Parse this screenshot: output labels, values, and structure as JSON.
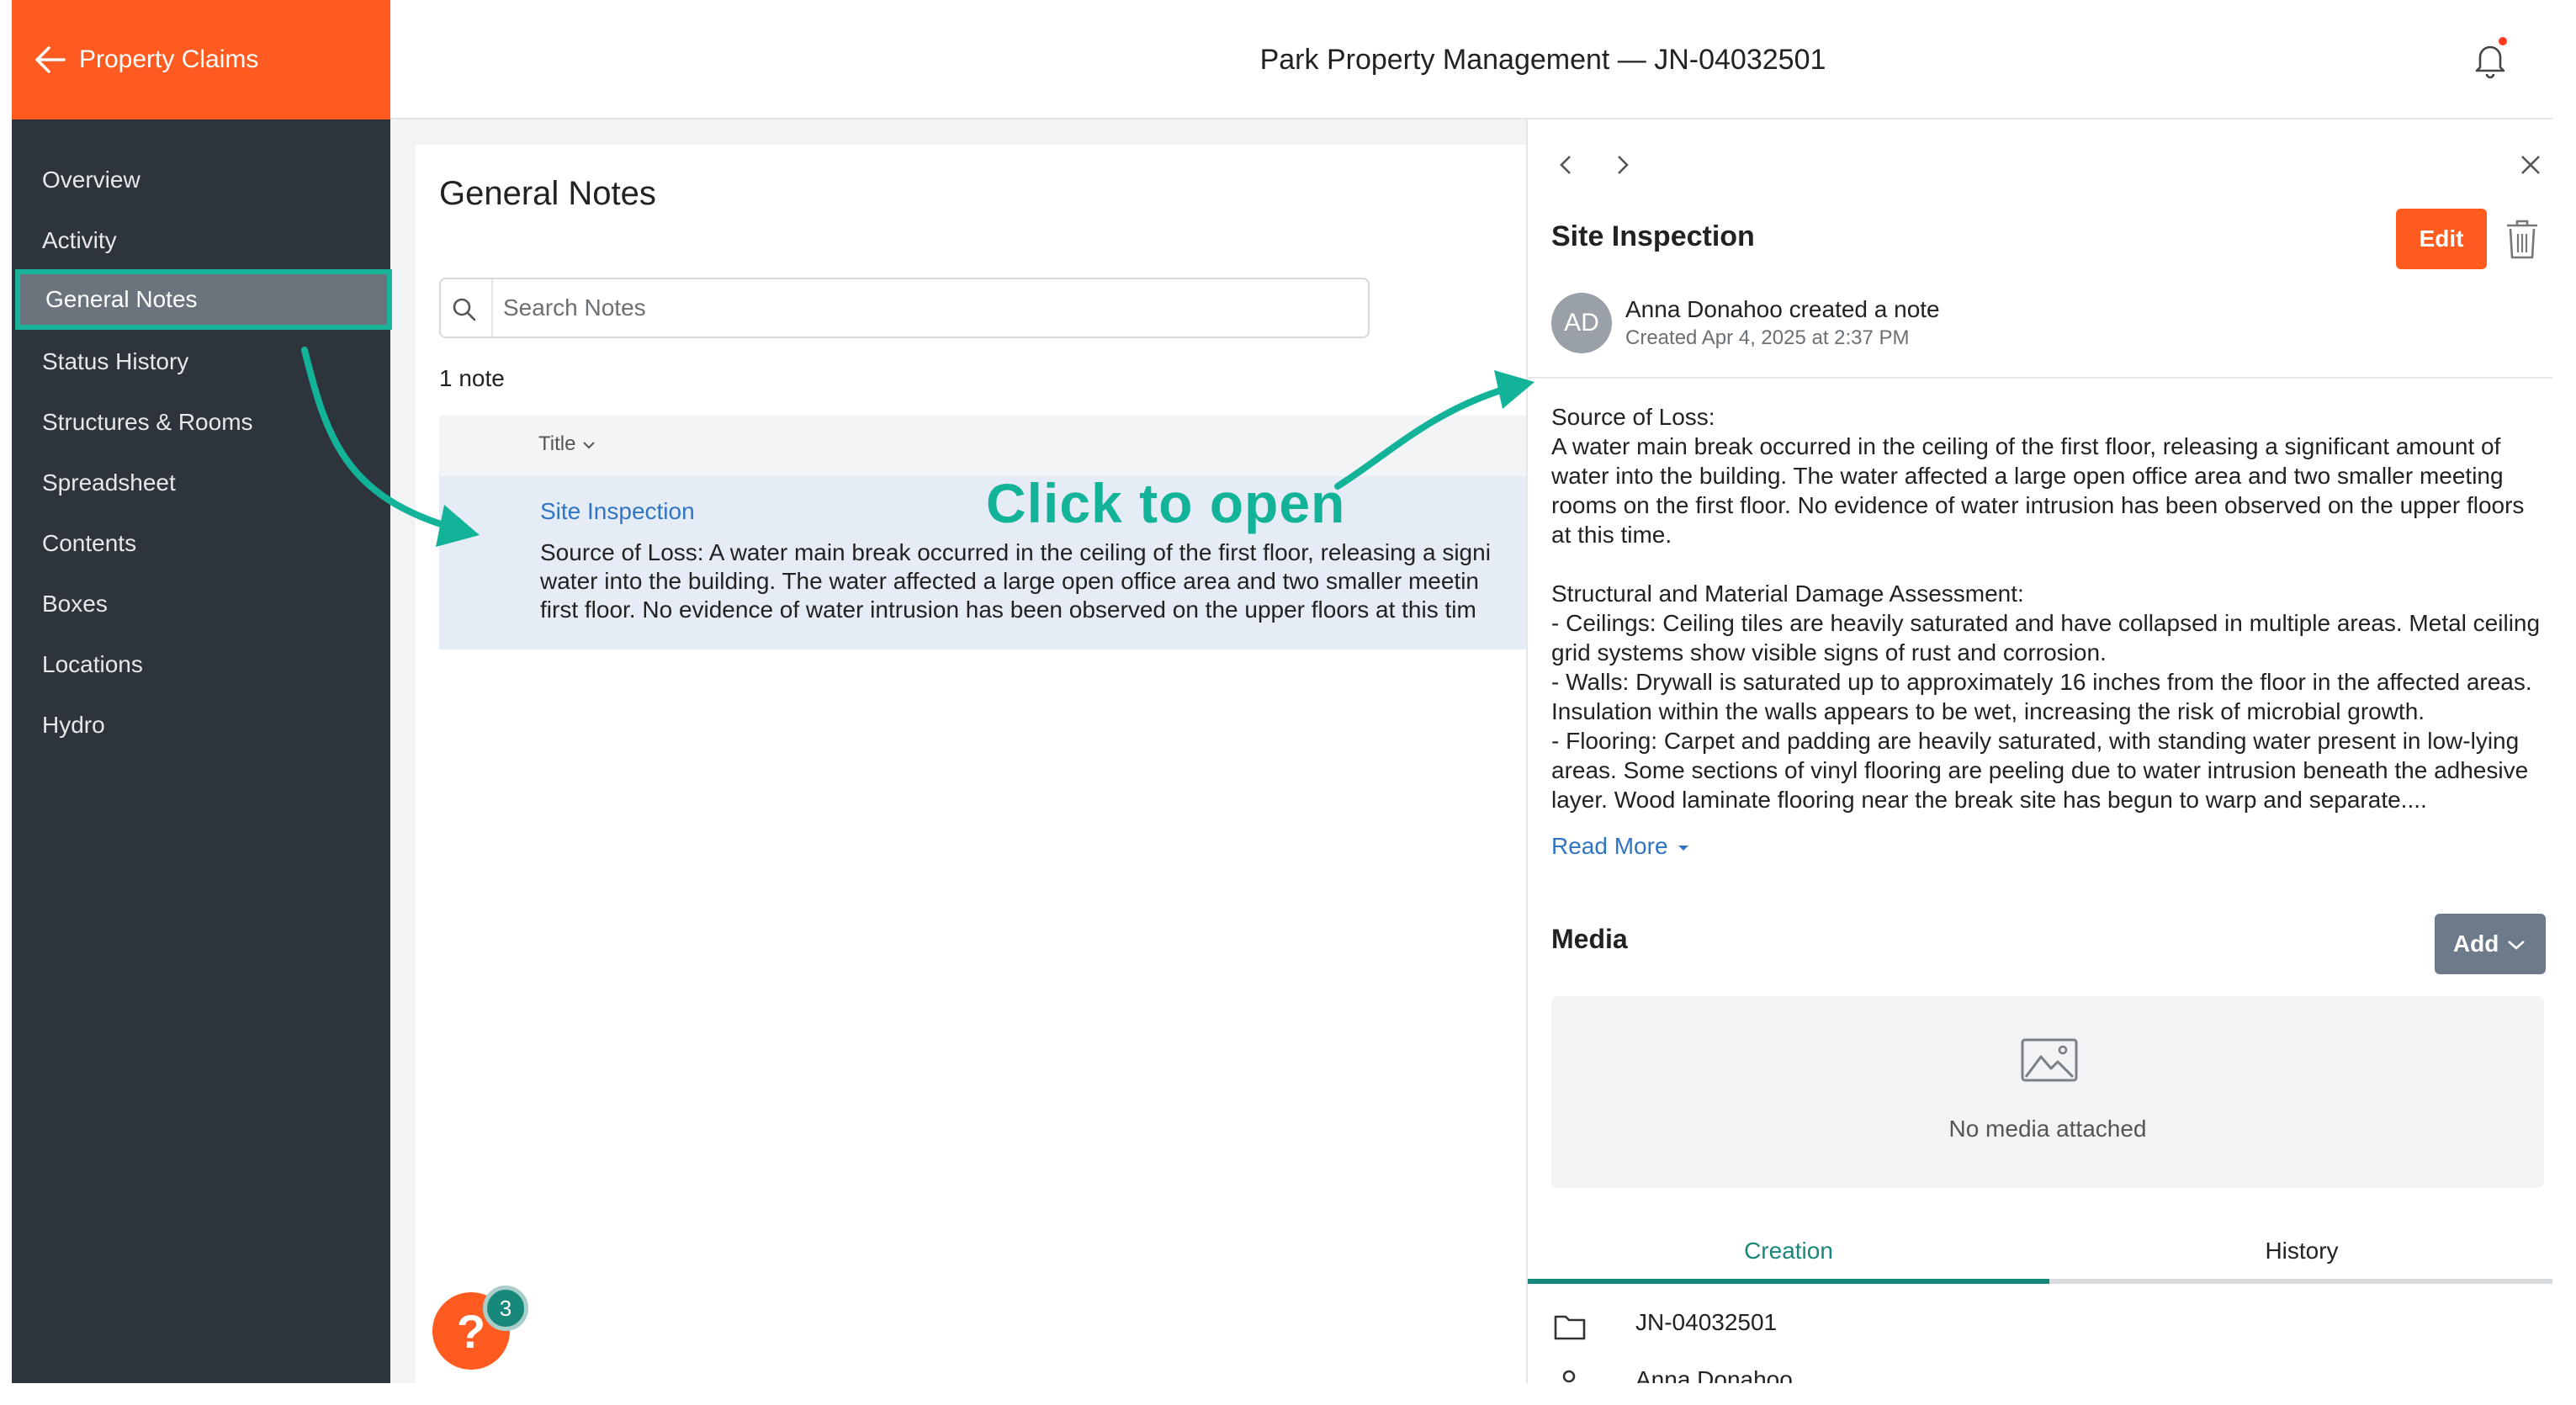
{
  "brand": {
    "back_label": "Property Claims"
  },
  "header": {
    "title": "Park Property Management — JN-04032501"
  },
  "sidebar": {
    "items": [
      {
        "label": "Overview"
      },
      {
        "label": "Activity"
      },
      {
        "label": "General Notes"
      },
      {
        "label": "Status History"
      },
      {
        "label": "Structures & Rooms"
      },
      {
        "label": "Spreadsheet"
      },
      {
        "label": "Contents"
      },
      {
        "label": "Boxes"
      },
      {
        "label": "Locations"
      },
      {
        "label": "Hydro"
      }
    ],
    "active_index": 2
  },
  "main": {
    "title": "General Notes",
    "search_placeholder": "Search Notes",
    "count": "1 note",
    "column_title": "Title",
    "rows": [
      {
        "title": "Site Inspection",
        "lines": [
          "Source of Loss: A water main break occurred in the ceiling of the first floor, releasing a signi",
          "water into the building. The water affected a large open office area and two smaller meetin",
          "first floor. No evidence of water intrusion has been observed on the upper floors at this tim"
        ]
      }
    ],
    "callout": "Click to open"
  },
  "help": {
    "icon": "question-icon",
    "badge": "3"
  },
  "detail": {
    "title": "Site Inspection",
    "edit_label": "Edit",
    "avatar_initials": "AD",
    "author": "Anna Donahoo created a note",
    "created": "Created Apr 4, 2025 at 2:37 PM",
    "body": {
      "p1": "Source of Loss:",
      "p2": "A water main break occurred in the ceiling of the first floor, releasing a significant amount of water into the building. The water affected a large open office area and two smaller meeting rooms on the first floor. No evidence of water intrusion has been observed on the upper floors at this time.",
      "p3": "Structural and Material Damage Assessment:",
      "p4": "- Ceilings: Ceiling tiles are heavily saturated and have collapsed in multiple areas. Metal ceiling grid systems show visible signs of rust and corrosion.",
      "p5": "- Walls: Drywall is saturated up to approximately 16 inches from the floor in the affected areas. Insulation within the walls appears to be wet, increasing the risk of microbial growth.",
      "p6": "- Flooring: Carpet and padding are heavily saturated, with standing water present in low-lying areas. Some sections of vinyl flooring are peeling due to water intrusion beneath the adhesive layer. Wood laminate flooring near the break site has begun to warp and separate...."
    },
    "read_more": "Read More",
    "media_title": "Media",
    "add_label": "Add",
    "no_media": "No media attached",
    "tabs": [
      {
        "label": "Creation"
      },
      {
        "label": "History"
      }
    ],
    "job_number": "JN-04032501",
    "cut_text": "Anna Donahoo"
  },
  "colors": {
    "brand": "#ff5a1f",
    "accent": "#17877a",
    "annotation": "#12b399",
    "link": "#2f75c4"
  }
}
